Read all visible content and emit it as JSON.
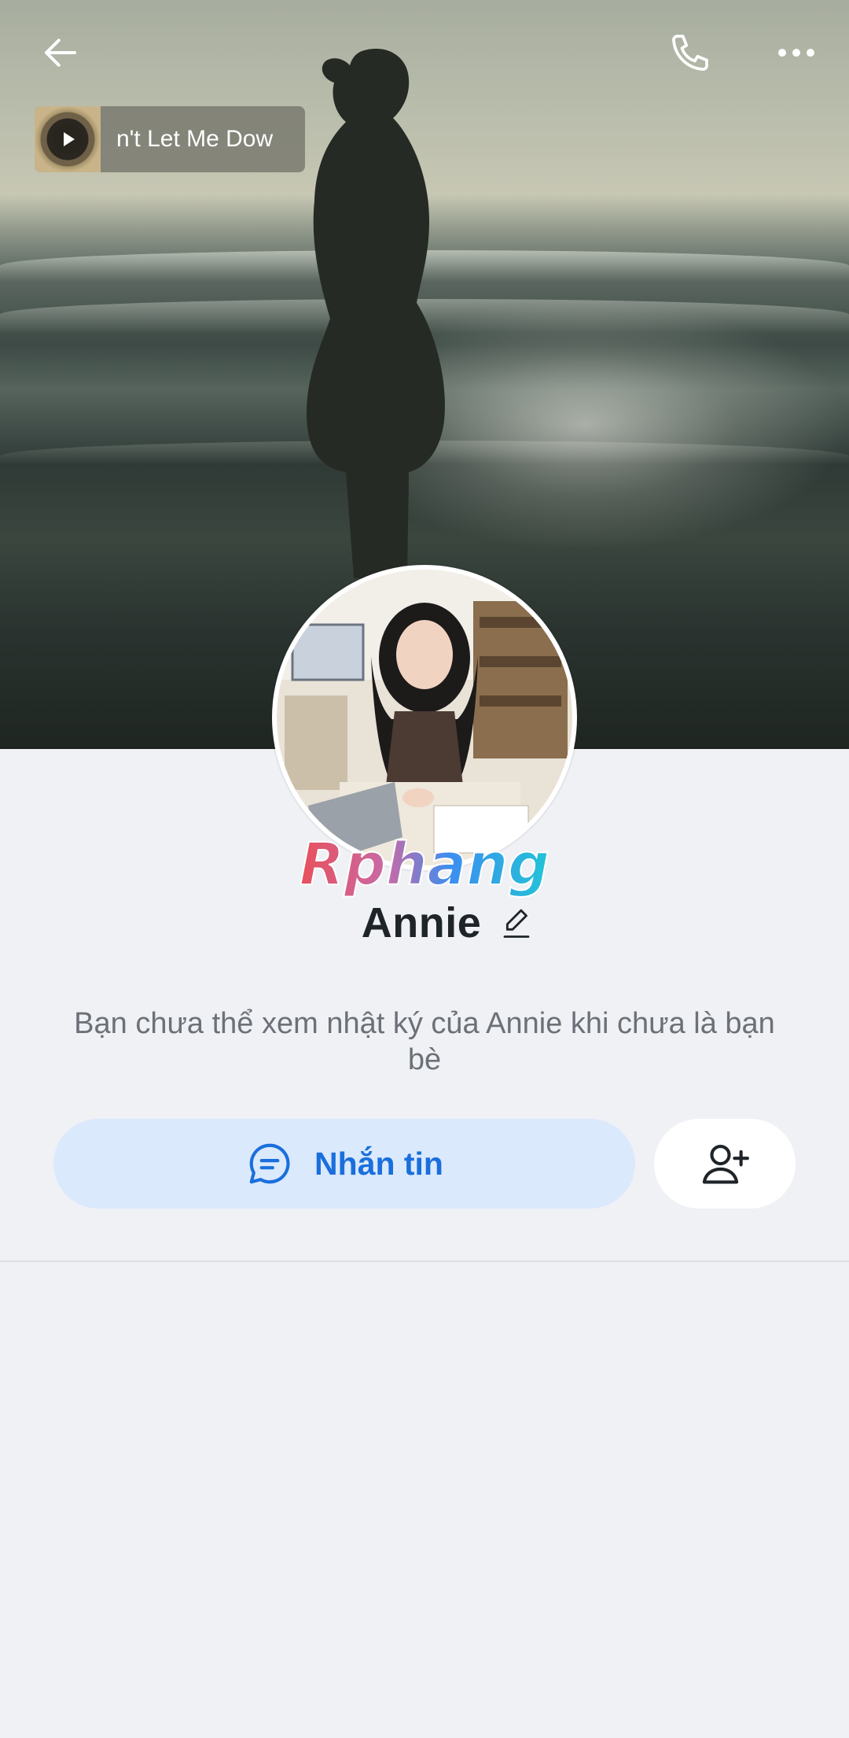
{
  "cover": {
    "music": {
      "title": "n't Let Me Dow",
      "icon": "play-icon"
    }
  },
  "topbar": {
    "back_icon": "arrow-left-icon",
    "call_icon": "phone-icon",
    "more_icon": "more-horizontal-icon"
  },
  "profile": {
    "name": "Annie",
    "logo_text": "Rphang",
    "privacy_note": "Bạn chưa thể xem nhật ký của Annie khi chưa là bạn bè"
  },
  "actions": {
    "message_label": "Nhắn tin",
    "message_icon": "chat-bubble-icon",
    "add_friend_icon": "add-user-icon"
  },
  "colors": {
    "accent": "#1a6fdc",
    "message_bg": "#dbe9fc",
    "page_bg": "#eff1f5"
  }
}
